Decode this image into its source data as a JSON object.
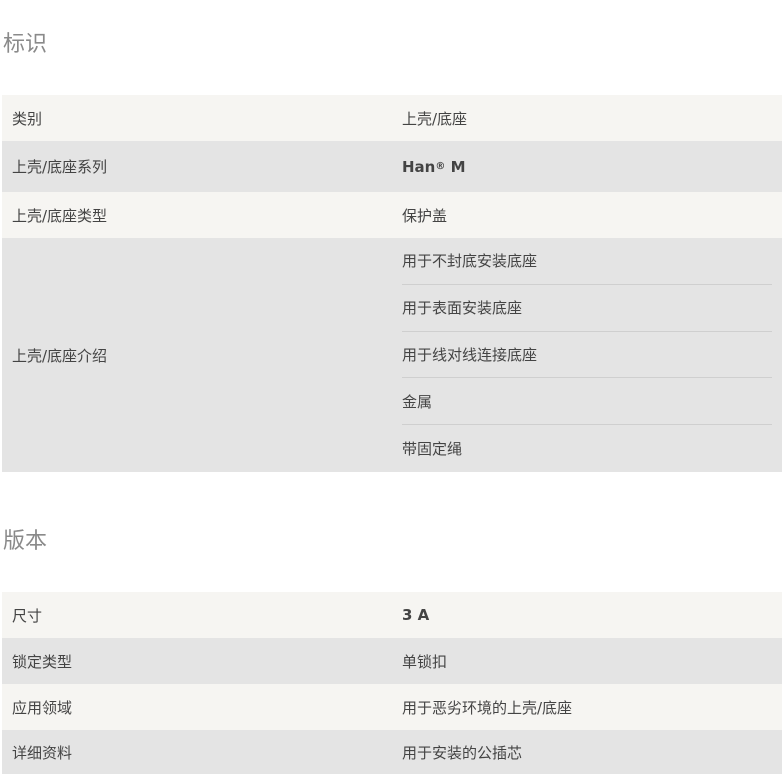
{
  "sections": [
    {
      "title": "标识",
      "rows": [
        {
          "label": "类别",
          "value": "上壳/底座"
        },
        {
          "label": "上壳/底座系列",
          "value": "Han",
          "sup": "®",
          "value_suffix": " M"
        },
        {
          "label": "上壳/底座类型",
          "value": "保护盖"
        },
        {
          "label": "上壳/底座介绍",
          "values": [
            "用于不封底安装底座",
            "用于表面安装底座",
            "用于线对线连接底座",
            "金属",
            "带固定绳"
          ]
        }
      ]
    },
    {
      "title": "版本",
      "rows": [
        {
          "label": "尺寸",
          "value": "3 A"
        },
        {
          "label": "锁定类型",
          "value": "单锁扣"
        },
        {
          "label": "应用领域",
          "value": "用于恶劣环境的上壳/底座"
        },
        {
          "label": "详细资料",
          "value": "用于安装的公插芯"
        }
      ]
    }
  ]
}
